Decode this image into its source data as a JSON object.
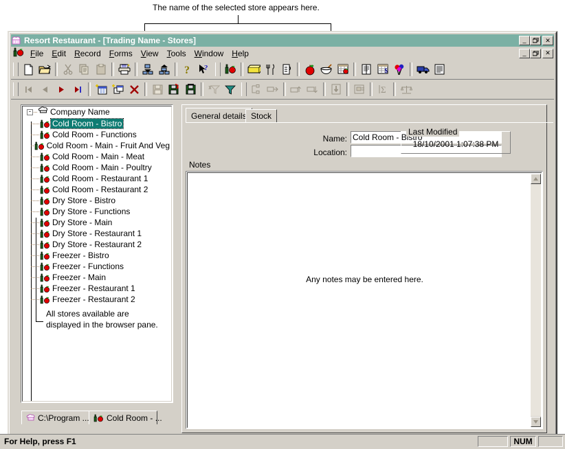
{
  "annotations": {
    "top": "The name of the selected store appears here.",
    "tree": [
      "All stores available are",
      "displayed in the browser pane."
    ]
  },
  "window": {
    "title": "Resort Restaurant - [Trading Name - Stores]",
    "icon": "chef-hat-icon",
    "buttons": {
      "minimize": "_",
      "restore": "❐",
      "close": "✕"
    }
  },
  "menu": {
    "icon": "bottle-apple-icon",
    "items": [
      {
        "label": "File",
        "accel": "F"
      },
      {
        "label": "Edit",
        "accel": "E"
      },
      {
        "label": "Record",
        "accel": "R"
      },
      {
        "label": "Forms",
        "accel": "F"
      },
      {
        "label": "View",
        "accel": "V"
      },
      {
        "label": "Tools",
        "accel": "T"
      },
      {
        "label": "Window",
        "accel": "W"
      },
      {
        "label": "Help",
        "accel": "H"
      }
    ]
  },
  "toolbar_top": [
    "new-document-icon",
    "open-folder-icon",
    "sep",
    "cut-scissors-icon",
    "copy-icon",
    "paste-icon",
    "sep",
    "print-icon",
    "sep",
    "collapse-tree-icon",
    "expand-tree-icon",
    "sep",
    "help-question-icon",
    "context-help-icon",
    "grip",
    "bottle-apple-icon",
    "sep",
    "butter-block-icon",
    "cutlery-icon",
    "measuring-jug-icon",
    "sep",
    "apple-icon",
    "mixing-bowl-icon",
    "recipe-card-icon",
    "sep",
    "document-list-icon",
    "price-grid-icon",
    "balloons-icon",
    "sep",
    "delivery-truck-icon",
    "report-icon"
  ],
  "toolbar_bottom": [
    "first-record-icon",
    "previous-record-icon",
    "next-record-icon",
    "last-record-icon",
    "sep",
    "new-record-icon",
    "new-form-icon",
    "delete-record-icon",
    "sep",
    "save-icon",
    "save-undo-icon",
    "save-close-icon",
    "sep",
    "filter-clear-icon",
    "filter-icon",
    "grip",
    "indent-left-icon",
    "indent-right-icon",
    "sep",
    "move-up-icon",
    "move-down-icon",
    "sep",
    "import-icon",
    "sep",
    "properties-icon",
    "sep",
    "sum-icon",
    "sep",
    "balance-icon"
  ],
  "tree": {
    "root": {
      "label": "Company Name",
      "icon": "chef-hat-icon",
      "expander": "-"
    },
    "items": [
      {
        "label": "Cold Room - Bistro",
        "selected": true
      },
      {
        "label": "Cold Room - Functions",
        "selected": false
      },
      {
        "label": "Cold Room - Main - Fruit And Veg",
        "selected": false
      },
      {
        "label": "Cold Room - Main - Meat",
        "selected": false
      },
      {
        "label": "Cold Room - Main - Poultry",
        "selected": false
      },
      {
        "label": "Cold Room - Restaurant 1",
        "selected": false
      },
      {
        "label": "Cold Room - Restaurant 2",
        "selected": false
      },
      {
        "label": "Dry Store - Bistro",
        "selected": false
      },
      {
        "label": "Dry Store - Functions",
        "selected": false
      },
      {
        "label": "Dry Store - Main",
        "selected": false
      },
      {
        "label": "Dry Store - Restaurant 1",
        "selected": false
      },
      {
        "label": "Dry Store - Restaurant 2",
        "selected": false
      },
      {
        "label": "Freezer - Bistro",
        "selected": false
      },
      {
        "label": "Freezer - Functions",
        "selected": false
      },
      {
        "label": "Freezer - Main",
        "selected": false
      },
      {
        "label": "Freezer - Restaurant 1",
        "selected": false
      },
      {
        "label": "Freezer - Restaurant 2",
        "selected": false
      }
    ],
    "item_icon": "bottle-apple-icon"
  },
  "form": {
    "tabs": [
      {
        "label": "General details",
        "active": true
      },
      {
        "label": "Stock",
        "active": false
      }
    ],
    "fields": {
      "name_label": "Name:",
      "name_value": "Cold Room - Bistro",
      "location_label": "Location:",
      "location_value": "",
      "notes_label": "Notes",
      "notes_value": "Any notes may be entered here."
    },
    "last_modified": {
      "title": "Last Modified",
      "value": "18/10/2001 1:07:38 PM"
    }
  },
  "mdi_tabs": [
    {
      "label": "C:\\Program ...",
      "icon": "chef-hat-icon",
      "active": false
    },
    {
      "label": "Cold Room - ...",
      "icon": "bottle-apple-icon",
      "active": true
    }
  ],
  "status": {
    "text": "For Help, press F1",
    "panes": [
      "",
      "NUM",
      ""
    ]
  },
  "colors": {
    "title_bar": "#7bb0a4",
    "face": "#d4d0c8",
    "selection": "#0d7b72",
    "apple_red": "#e00000",
    "bottle_green": "#1a5c1a"
  }
}
